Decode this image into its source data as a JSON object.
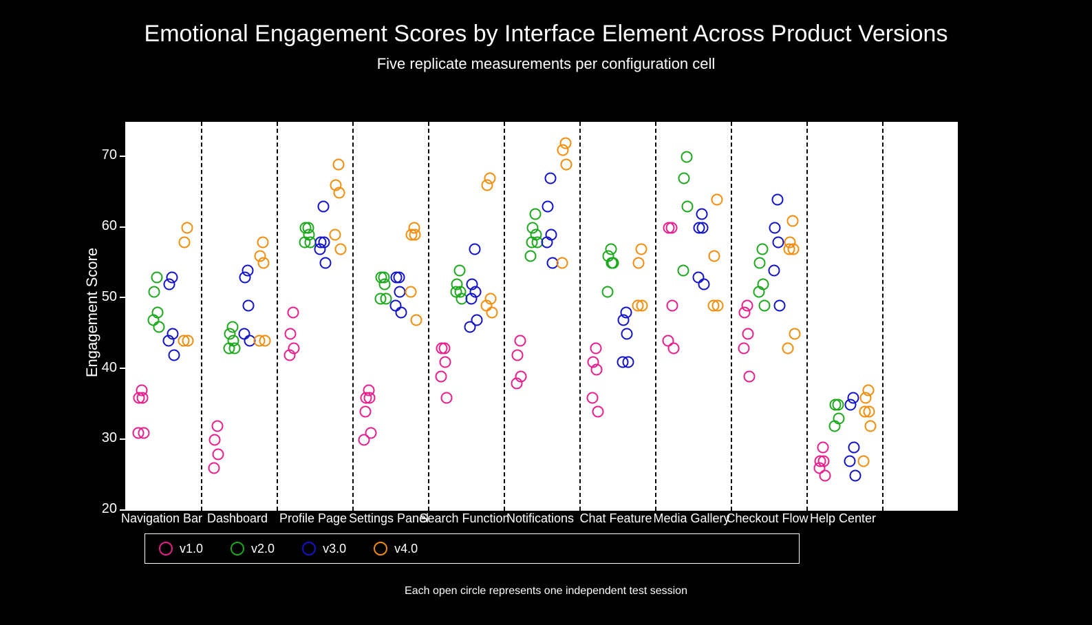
{
  "title": "Emotional Engagement Scores by Interface Element Across Product Versions",
  "subtitle": "Five replicate measurements per configuration cell",
  "ylabel": "Engagement Score",
  "footer": "Each open circle represents one independent test session",
  "xlim": [
    -0.5,
    10.5
  ],
  "ylim": [
    20,
    75
  ],
  "colors": {
    "v1.0": "#e81e8c",
    "v2.0": "#1ca81c",
    "v3.0": "#1212c8",
    "v4.0": "#f28c0a"
  },
  "chart_data": {
    "type": "scatter",
    "xlabel": "",
    "ylabel": "Engagement Score",
    "xlim": [
      -0.5,
      10.5
    ],
    "ylim": [
      20,
      75
    ],
    "yticks": [
      20,
      30,
      40,
      50,
      60,
      70
    ],
    "categories": [
      "Navigation Bar",
      "Dashboard",
      "Profile Page",
      "Settings Panel",
      "Search Function",
      "Notifications",
      "Chat Feature",
      "Media Gallery",
      "Checkout Flow",
      "Help Center"
    ],
    "vlines_x": [
      0.5,
      1.5,
      2.5,
      3.5,
      4.5,
      5.5,
      6.5,
      7.5,
      8.5,
      9.5
    ],
    "series": [
      {
        "name": "v1.0",
        "color": "#e81e8c"
      },
      {
        "name": "v2.0",
        "color": "#1ca81c"
      },
      {
        "name": "v3.0",
        "color": "#1212c8"
      },
      {
        "name": "v4.0",
        "color": "#f28c0a"
      }
    ],
    "points": [
      {
        "cat": 0,
        "series": "v1.0",
        "values": [
          37,
          36,
          36,
          31,
          31
        ]
      },
      {
        "cat": 0,
        "series": "v2.0",
        "values": [
          53,
          51,
          48,
          47,
          46
        ]
      },
      {
        "cat": 0,
        "series": "v3.0",
        "values": [
          53,
          52,
          45,
          44,
          42
        ]
      },
      {
        "cat": 0,
        "series": "v4.0",
        "values": [
          60,
          58,
          44,
          44
        ]
      },
      {
        "cat": 1,
        "series": "v1.0",
        "values": [
          32,
          30,
          28,
          26
        ]
      },
      {
        "cat": 1,
        "series": "v2.0",
        "values": [
          46,
          45,
          44,
          43,
          43
        ]
      },
      {
        "cat": 1,
        "series": "v3.0",
        "values": [
          54,
          53,
          49,
          45,
          44
        ]
      },
      {
        "cat": 1,
        "series": "v4.0",
        "values": [
          58,
          56,
          55,
          44,
          44
        ]
      },
      {
        "cat": 2,
        "series": "v1.0",
        "values": [
          48,
          45,
          43,
          42
        ]
      },
      {
        "cat": 2,
        "series": "v2.0",
        "values": [
          60,
          60,
          59,
          58,
          58
        ]
      },
      {
        "cat": 2,
        "series": "v3.0",
        "values": [
          63,
          58,
          58,
          57,
          55
        ]
      },
      {
        "cat": 2,
        "series": "v4.0",
        "values": [
          69,
          66,
          65,
          59,
          57
        ]
      },
      {
        "cat": 3,
        "series": "v1.0",
        "values": [
          37,
          36,
          36,
          34,
          31,
          30
        ]
      },
      {
        "cat": 3,
        "series": "v2.0",
        "values": [
          53,
          53,
          52,
          50,
          50
        ]
      },
      {
        "cat": 3,
        "series": "v3.0",
        "values": [
          53,
          53,
          51,
          49,
          48
        ]
      },
      {
        "cat": 3,
        "series": "v4.0",
        "values": [
          60,
          59,
          59,
          51,
          47
        ]
      },
      {
        "cat": 4,
        "series": "v1.0",
        "values": [
          43,
          43,
          41,
          39,
          36
        ]
      },
      {
        "cat": 4,
        "series": "v2.0",
        "values": [
          54,
          52,
          51,
          51,
          50
        ]
      },
      {
        "cat": 4,
        "series": "v3.0",
        "values": [
          57,
          52,
          51,
          50,
          47,
          46
        ]
      },
      {
        "cat": 4,
        "series": "v4.0",
        "values": [
          67,
          66,
          50,
          49,
          48
        ]
      },
      {
        "cat": 5,
        "series": "v1.0",
        "values": [
          44,
          42,
          39,
          38
        ]
      },
      {
        "cat": 5,
        "series": "v2.0",
        "values": [
          62,
          60,
          59,
          58,
          58,
          56
        ]
      },
      {
        "cat": 5,
        "series": "v3.0",
        "values": [
          67,
          63,
          59,
          58,
          55
        ]
      },
      {
        "cat": 5,
        "series": "v4.0",
        "values": [
          72,
          71,
          69,
          55
        ]
      },
      {
        "cat": 6,
        "series": "v1.0",
        "values": [
          43,
          41,
          40,
          36,
          34
        ]
      },
      {
        "cat": 6,
        "series": "v2.0",
        "values": [
          57,
          56,
          55,
          51,
          55
        ]
      },
      {
        "cat": 6,
        "series": "v3.0",
        "values": [
          48,
          47,
          45,
          41,
          41
        ]
      },
      {
        "cat": 6,
        "series": "v4.0",
        "values": [
          57,
          55,
          49,
          49
        ]
      },
      {
        "cat": 7,
        "series": "v1.0",
        "values": [
          60,
          60,
          49,
          44,
          43
        ]
      },
      {
        "cat": 7,
        "series": "v2.0",
        "values": [
          70,
          67,
          63,
          54
        ]
      },
      {
        "cat": 7,
        "series": "v3.0",
        "values": [
          62,
          60,
          60,
          53,
          52
        ]
      },
      {
        "cat": 7,
        "series": "v4.0",
        "values": [
          64,
          56,
          49,
          49
        ]
      },
      {
        "cat": 8,
        "series": "v1.0",
        "values": [
          49,
          48,
          45,
          43,
          39
        ]
      },
      {
        "cat": 8,
        "series": "v2.0",
        "values": [
          57,
          55,
          52,
          51,
          49
        ]
      },
      {
        "cat": 8,
        "series": "v3.0",
        "values": [
          64,
          60,
          58,
          54,
          49
        ]
      },
      {
        "cat": 8,
        "series": "v4.0",
        "values": [
          61,
          58,
          57,
          57,
          45,
          43
        ]
      },
      {
        "cat": 9,
        "series": "v1.0",
        "values": [
          29,
          27,
          27,
          26,
          25
        ]
      },
      {
        "cat": 9,
        "series": "v2.0",
        "values": [
          35,
          35,
          33,
          32
        ]
      },
      {
        "cat": 9,
        "series": "v3.0",
        "values": [
          36,
          35,
          29,
          27,
          25
        ]
      },
      {
        "cat": 9,
        "series": "v4.0",
        "values": [
          37,
          36,
          34,
          34,
          32,
          27
        ]
      }
    ]
  },
  "legend_items": [
    {
      "name": "v1.0",
      "label": "v1.0"
    },
    {
      "name": "v2.0",
      "label": "v2.0"
    },
    {
      "name": "v3.0",
      "label": "v3.0"
    },
    {
      "name": "v4.0",
      "label": "v4.0"
    }
  ]
}
